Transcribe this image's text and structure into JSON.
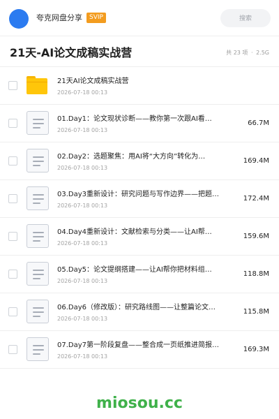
{
  "app": {
    "name": "夸克网盘分享",
    "badge": "SVIP",
    "accent_color": "#2b7bf0",
    "badge_color": "#f39c1f"
  },
  "search": {
    "label": "搜索"
  },
  "folder": {
    "title": "21天-AI论文成稿实战营",
    "count_text": "共 23 项",
    "separator": "·",
    "total_size": "2.5G"
  },
  "files": [
    {
      "type": "folder",
      "icon": "folder-icon",
      "name": "21天AI论文成稿实战营",
      "date": "2026-07-18 00:13",
      "size": ""
    },
    {
      "type": "document",
      "icon": "document-icon",
      "name": "01.Day1：论文现状诊断——教你第一次跟AI看…",
      "date": "2026-07-18 00:13",
      "size": "66.7M"
    },
    {
      "type": "document",
      "icon": "document-icon",
      "name": "02.Day2：选题聚焦：用AI将“大方向”转化为…",
      "date": "2026-07-18 00:13",
      "size": "169.4M"
    },
    {
      "type": "document",
      "icon": "document-icon",
      "name": "03.Day3重新设计：研究问题与写作边界——把题…",
      "date": "2026-07-18 00:13",
      "size": "172.4M"
    },
    {
      "type": "document",
      "icon": "document-icon",
      "name": "04.Day4重新设计：文献检索与分类——让AI帮…",
      "date": "2026-07-18 00:13",
      "size": "159.6M"
    },
    {
      "type": "document",
      "icon": "document-icon",
      "name": "05.Day5：论文提纲搭建——让AI帮你把材料组…",
      "date": "2026-07-18 00:13",
      "size": "118.8M"
    },
    {
      "type": "document",
      "icon": "document-icon",
      "name": "06.Day6（修改版）：研究路线图——让整篇论文…",
      "date": "2026-07-18 00:13",
      "size": "115.8M"
    },
    {
      "type": "document",
      "icon": "document-icon",
      "name": "07.Day7第一阶段复盘——整合成一页纸推进简报…",
      "date": "2026-07-18 00:13",
      "size": "169.3M"
    }
  ],
  "watermark": "miosou.cc"
}
